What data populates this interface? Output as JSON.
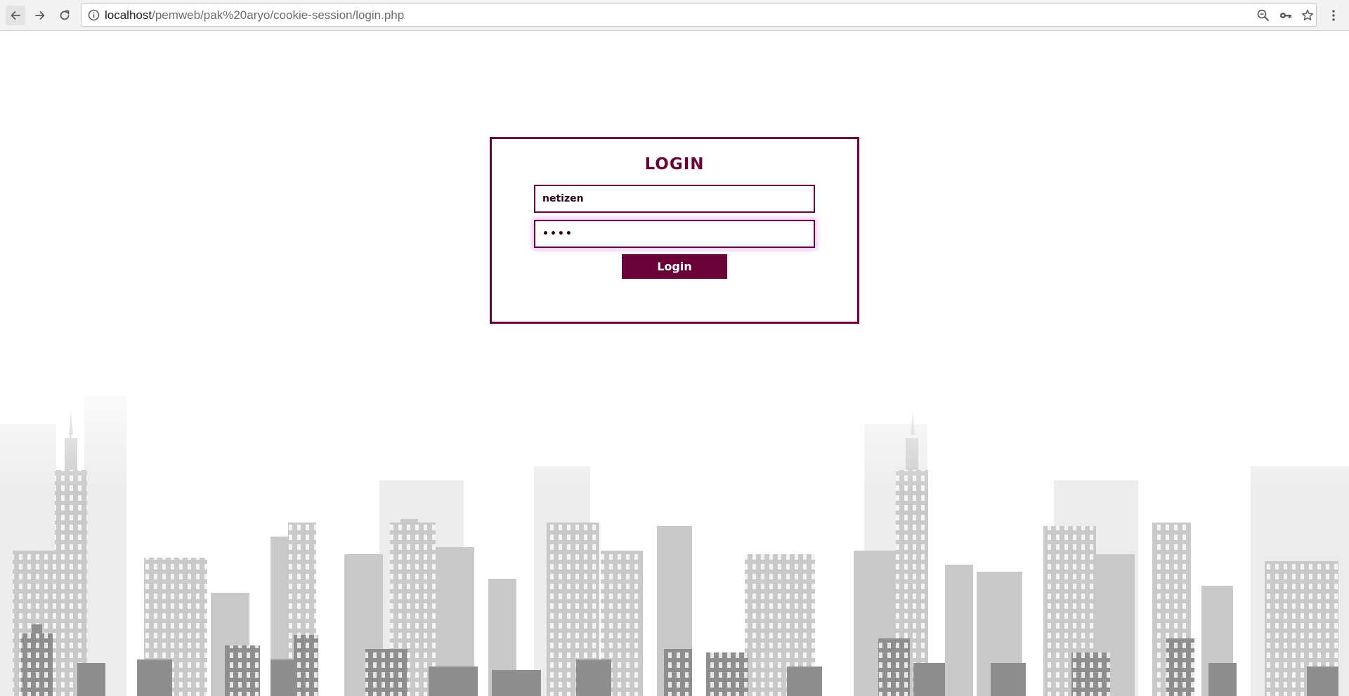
{
  "browser": {
    "url_host": "localhost",
    "url_path": "/pemweb/pak%20aryo/cookie-session/login.php",
    "icons": {
      "back": "back-arrow-icon",
      "forward": "forward-arrow-icon",
      "reload": "reload-icon",
      "info": "info-icon",
      "zoom": "zoom-out-icon",
      "key": "key-icon",
      "star": "bookmark-star-icon",
      "menu": "more-vert-icon"
    }
  },
  "login": {
    "title": "LOGIN",
    "username_value": "netizen",
    "password_value": "pass",
    "button_label": "Login"
  },
  "colors": {
    "accent": "#690236",
    "focus_glow": "#d278e6",
    "skyline_dark": "#8a8a8a",
    "skyline_light": "#c8c8c8"
  }
}
